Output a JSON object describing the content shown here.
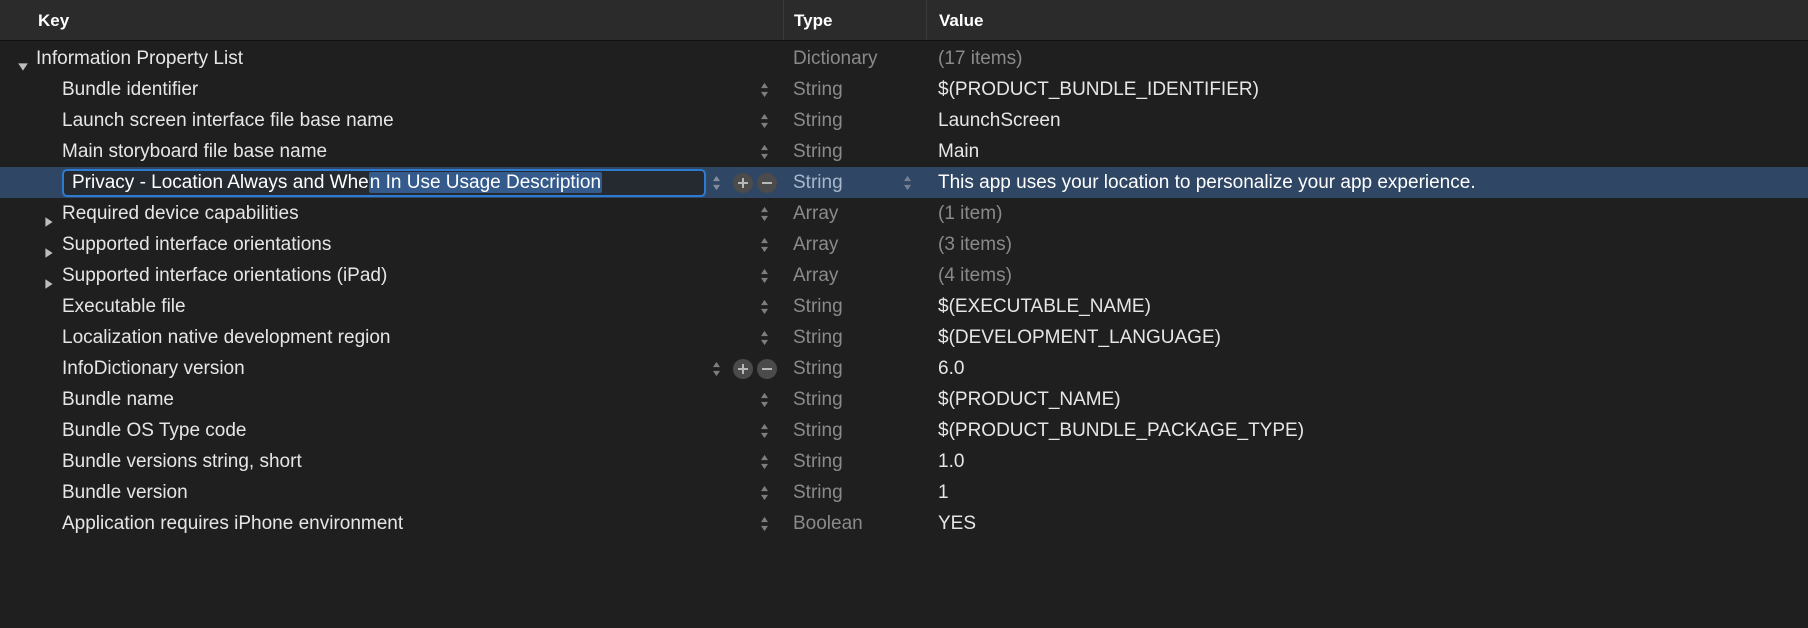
{
  "columns": {
    "key": "Key",
    "type": "Type",
    "value": "Value"
  },
  "root": {
    "key": "Information Property List",
    "type": "Dictionary",
    "value": "(17 items)",
    "expanded": true
  },
  "rows": [
    {
      "key": "Bundle identifier",
      "type": "String",
      "value": "$(PRODUCT_BUNDLE_IDENTIFIER)",
      "stepper": true
    },
    {
      "key": "Launch screen interface file base name",
      "type": "String",
      "value": "LaunchScreen",
      "stepper": true
    },
    {
      "key": "Main storyboard file base name",
      "type": "String",
      "value": "Main",
      "stepper": true
    },
    {
      "selected": true,
      "editing": true,
      "key_prefix": "Privacy - Location Always and Whe",
      "key_selected": "n In Use Usage Description",
      "type": "String",
      "value": "This app uses your location to personalize your app experience.",
      "stepper": true,
      "add_remove": true,
      "type_stepper": true
    },
    {
      "key": "Required device capabilities",
      "type": "Array",
      "value": "(1 item)",
      "disclosure": "right",
      "stepper": true,
      "array": true
    },
    {
      "key": "Supported interface orientations",
      "type": "Array",
      "value": "(3 items)",
      "disclosure": "right",
      "stepper": true,
      "array": true
    },
    {
      "key": "Supported interface orientations (iPad)",
      "type": "Array",
      "value": "(4 items)",
      "disclosure": "right",
      "stepper": true,
      "array": true
    },
    {
      "key": "Executable file",
      "type": "String",
      "value": "$(EXECUTABLE_NAME)",
      "stepper": true
    },
    {
      "key": "Localization native development region",
      "type": "String",
      "value": "$(DEVELOPMENT_LANGUAGE)",
      "stepper": true
    },
    {
      "key": "InfoDictionary version",
      "type": "String",
      "value": "6.0",
      "stepper": true,
      "add_remove": true
    },
    {
      "key": "Bundle name",
      "type": "String",
      "value": "$(PRODUCT_NAME)",
      "stepper": true
    },
    {
      "key": "Bundle OS Type code",
      "type": "String",
      "value": "$(PRODUCT_BUNDLE_PACKAGE_TYPE)",
      "stepper": true
    },
    {
      "key": "Bundle versions string, short",
      "type": "String",
      "value": "1.0",
      "stepper": true
    },
    {
      "key": "Bundle version",
      "type": "String",
      "value": "1",
      "stepper": true
    },
    {
      "key": "Application requires iPhone environment",
      "type": "Boolean",
      "value": "YES",
      "stepper": true
    }
  ]
}
